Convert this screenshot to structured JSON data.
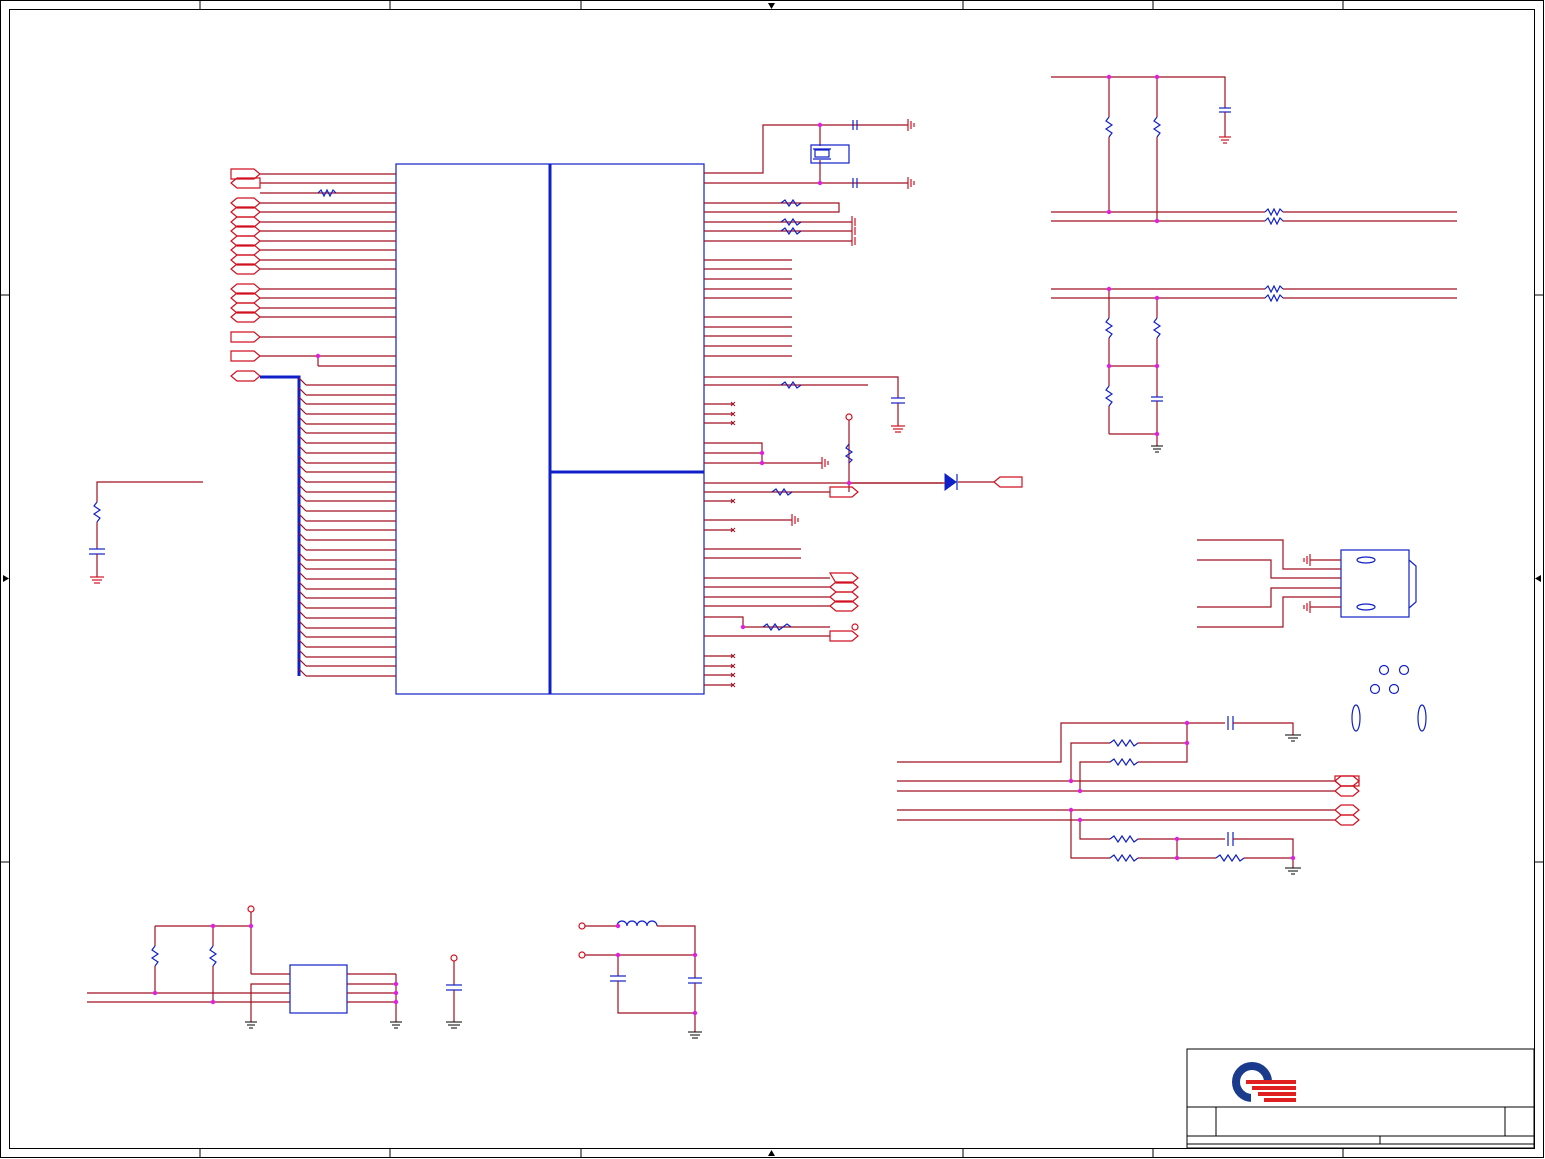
{
  "sheet": {
    "logo": "quanta-q-logo",
    "title_block_text": ""
  },
  "colors": {
    "wire": "#a01020",
    "component": "#1020c8",
    "port": "#d01020",
    "junction": "#e020e0",
    "frame": "#000000"
  },
  "icons": [
    "ground-icon",
    "resistor-icon",
    "capacitor-icon",
    "crystal-icon",
    "diode-icon",
    "inductor-icon",
    "connector-icon",
    "port-icon",
    "test-point-icon",
    "mounting-hole-icon"
  ]
}
